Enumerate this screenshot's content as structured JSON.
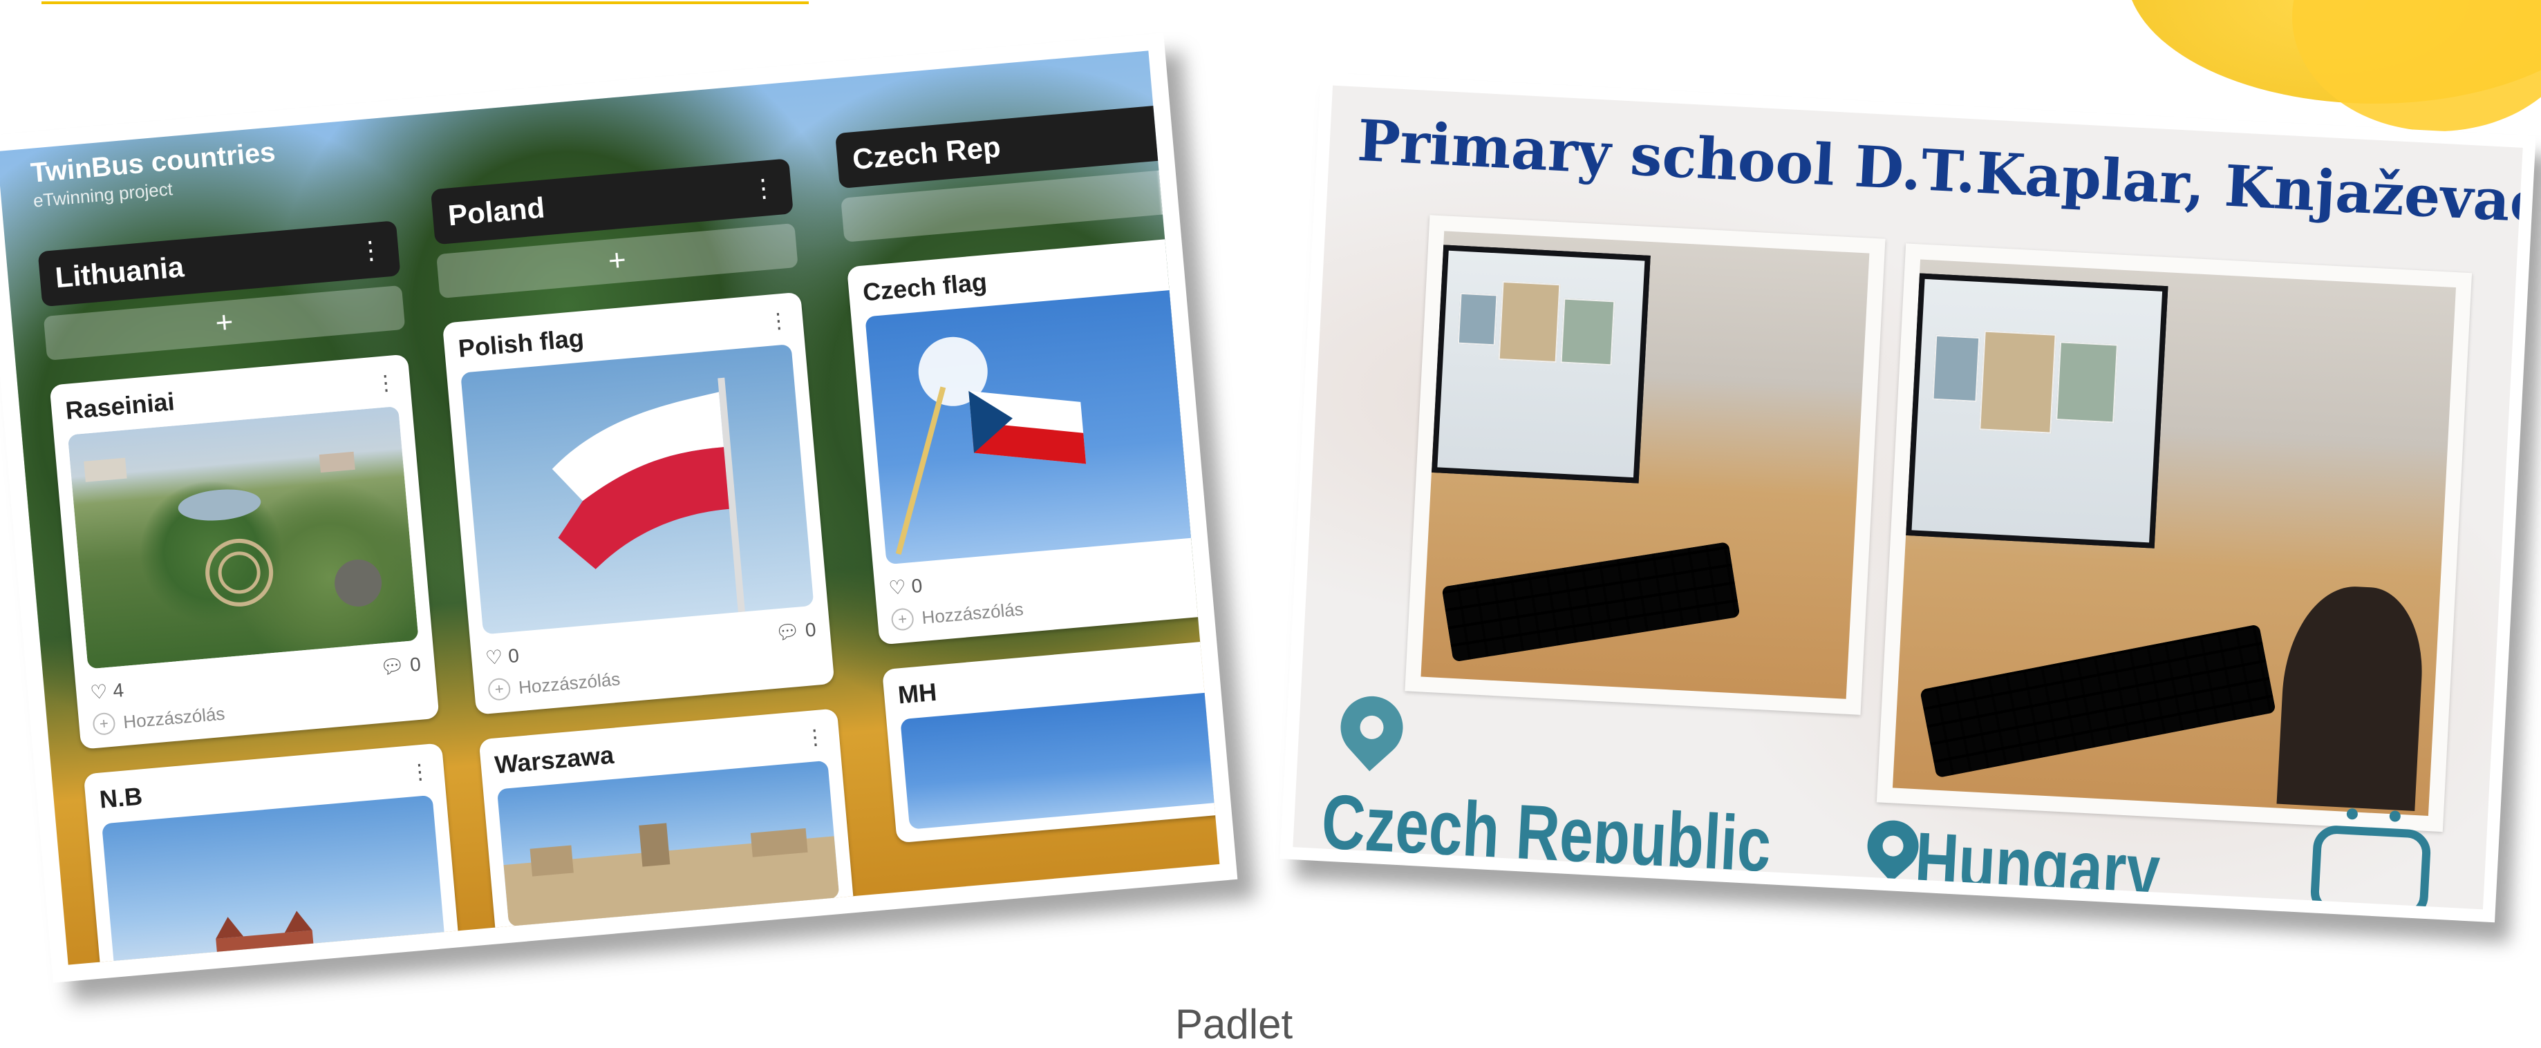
{
  "padlet": {
    "title": "TwinBus countries",
    "subtitle": "eTwinning project",
    "columns": [
      {
        "name": "Lithuania",
        "cards": [
          {
            "title": "Raseiniai",
            "likes": "4",
            "comments": "0",
            "comment_prompt": "Hozzászólás"
          },
          {
            "title": "N.B"
          }
        ]
      },
      {
        "name": "Poland",
        "cards": [
          {
            "title": "Polish flag",
            "likes": "0",
            "comments": "0",
            "comment_prompt": "Hozzászólás"
          },
          {
            "title": "Warszawa"
          }
        ]
      },
      {
        "name": "Czech Rep",
        "cards": [
          {
            "title": "Czech flag",
            "likes": "0",
            "comment_prompt": "Hozzászólás"
          },
          {
            "title": "MH"
          }
        ]
      }
    ],
    "add_symbol": "+",
    "kebab_symbol": "⋮"
  },
  "poster": {
    "title": "Primary school D.T.Kaplar, Knjaževac",
    "labels": [
      "Czech Republic",
      "Hungary"
    ]
  },
  "caption": "Padlet",
  "colors": {
    "accent_yellow": "#f6c72a",
    "poster_title_blue": "#153c8c",
    "poster_teal": "#2f7f95"
  }
}
